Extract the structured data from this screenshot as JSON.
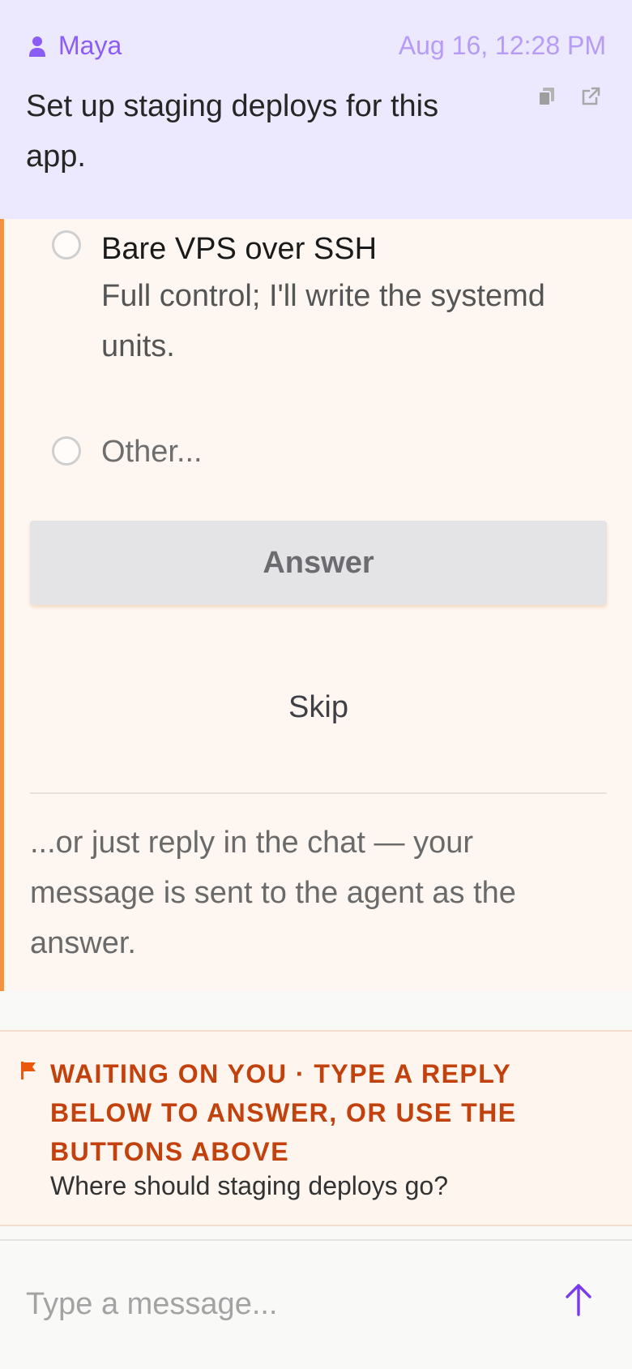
{
  "message": {
    "author": "Maya",
    "timestamp": "Aug 16, 12:28 PM",
    "text": "Set up staging deploys for this app.",
    "icons": [
      "person-icon",
      "copy-icon",
      "external-link-icon"
    ]
  },
  "question_card": {
    "options": [
      {
        "title": "Bare VPS over SSH",
        "description": "Full control; I'll write the systemd units.",
        "selected": false
      },
      {
        "title": "Other...",
        "selected": false
      }
    ],
    "answer_label": "Answer",
    "skip_label": "Skip",
    "hint": "...or just reply in the chat — your message is sent to the agent as the answer."
  },
  "waiting_banner": {
    "title": "WAITING ON YOU · TYPE A REPLY BELOW TO ANSWER, OR USE THE BUTTONS ABOVE",
    "question": "Where should staging deploys go?",
    "icon": "flag-icon"
  },
  "composer": {
    "placeholder": "Type a message...",
    "value": "",
    "send_icon": "arrow-up-icon"
  },
  "colors": {
    "accent": "#8b5cf6",
    "header_bg": "#ece8fd",
    "card_bg": "#fef7f1",
    "card_border": "#f5923e",
    "warning": "#c2410c"
  }
}
